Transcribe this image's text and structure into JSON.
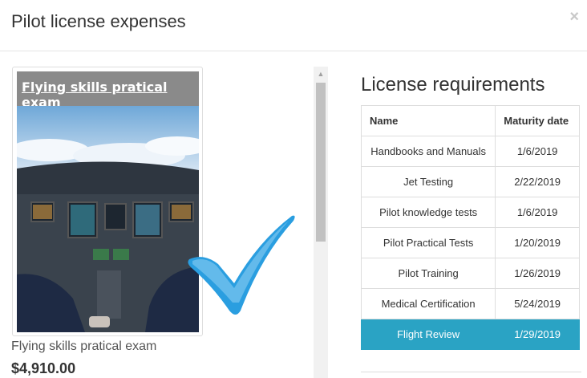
{
  "modal": {
    "title": "Pilot license expenses",
    "close_glyph": "×"
  },
  "product": {
    "image_title": "Flying skills pratical exam",
    "name": "Flying skills pratical exam",
    "price": "$4,910.00"
  },
  "requirements": {
    "title": "License requirements",
    "columns": [
      "Name",
      "Maturity date"
    ],
    "rows": [
      {
        "name": "Handbooks and Manuals",
        "date": "1/6/2019"
      },
      {
        "name": "Jet Testing",
        "date": "2/22/2019"
      },
      {
        "name": "Pilot knowledge tests",
        "date": "1/6/2019"
      },
      {
        "name": "Pilot Practical Tests",
        "date": "1/20/2019"
      },
      {
        "name": "Pilot Training",
        "date": "1/26/2019"
      },
      {
        "name": "Medical Certification",
        "date": "5/24/2019"
      },
      {
        "name": "Flight Review",
        "date": "1/29/2019"
      }
    ],
    "selected_index": 6
  },
  "colors": {
    "selected_row": "#2aa3c4",
    "checkmark": "#2a9ee0"
  }
}
